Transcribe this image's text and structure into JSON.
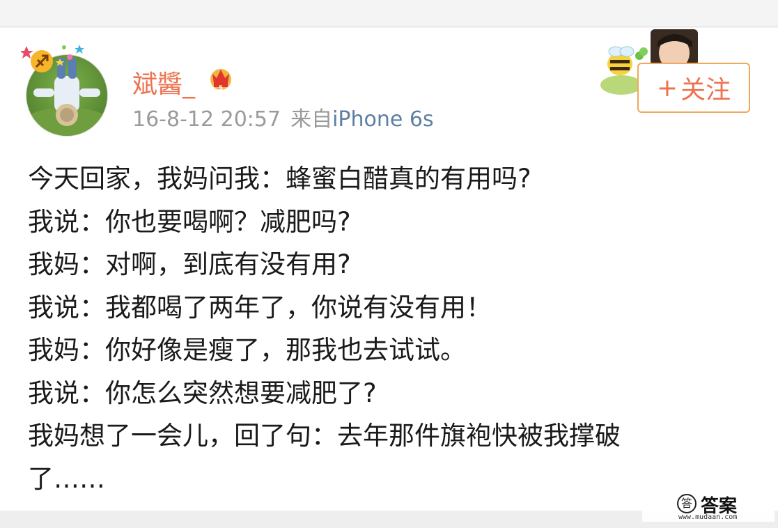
{
  "post": {
    "author": "斌醬_",
    "time": "16-8-12 20:57",
    "source_prefix": "来自",
    "device": "iPhone 6s",
    "follow_plus": "+",
    "follow_label": "关注",
    "lines": [
      "今天回家，我妈问我：蜂蜜白醋真的有用吗?",
      "我说：你也要喝啊？减肥吗?",
      "我妈：对啊，到底有没有用?",
      "我说：我都喝了两年了，你说有没有用！",
      "我妈：你好像是瘦了，那我也去试试。",
      "我说：你怎么突然想要减肥了?",
      "我妈想了一会儿，回了句：去年那件旗袍快被我撑破",
      "了……"
    ]
  },
  "watermark": {
    "logo_char": "答",
    "text": "答案",
    "url": "www.mudaan.com"
  },
  "colors": {
    "accent": "#eb7350",
    "button_border": "#f0a85a",
    "meta_gray": "#9a9a9a",
    "device_blue": "#5d7fa4"
  },
  "icons": {
    "avatar": "user-avatar",
    "badge": "sagittarius-badge-icon",
    "vip": "crown-vip-icon",
    "sticker": "bee-sticker-icon",
    "watermark_logo": "watermark-logo-icon"
  }
}
